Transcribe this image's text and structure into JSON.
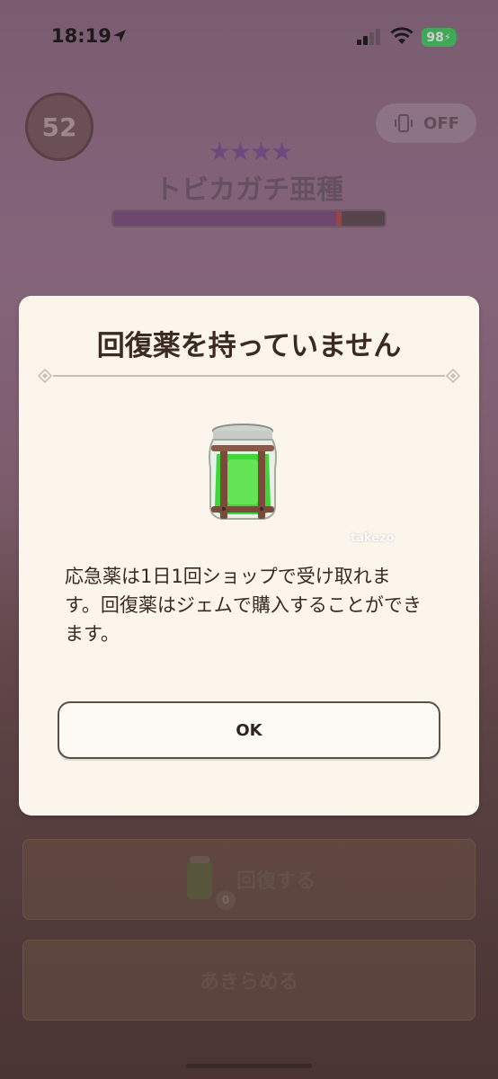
{
  "status_bar": {
    "time": "18:19",
    "battery": "98"
  },
  "battle": {
    "timer": "52",
    "vibration_toggle": "OFF",
    "stars": "★★★★",
    "monster_name": "トビカガチ亜種",
    "hp_fraction": 0.83
  },
  "actions": {
    "heal_label": "回復する",
    "heal_count": "0",
    "give_up_label": "あきらめる"
  },
  "dialog": {
    "title": "回復薬を持っていません",
    "watermark": "takezo",
    "body": "応急薬は1日1回ショップで受け取れます。回復薬はジェムで購入することができます。",
    "ok_label": "OK"
  },
  "colors": {
    "dialog_bg": "#fbf5ec",
    "potion_green": "#3fd63a",
    "battery_green": "#3bd160"
  }
}
